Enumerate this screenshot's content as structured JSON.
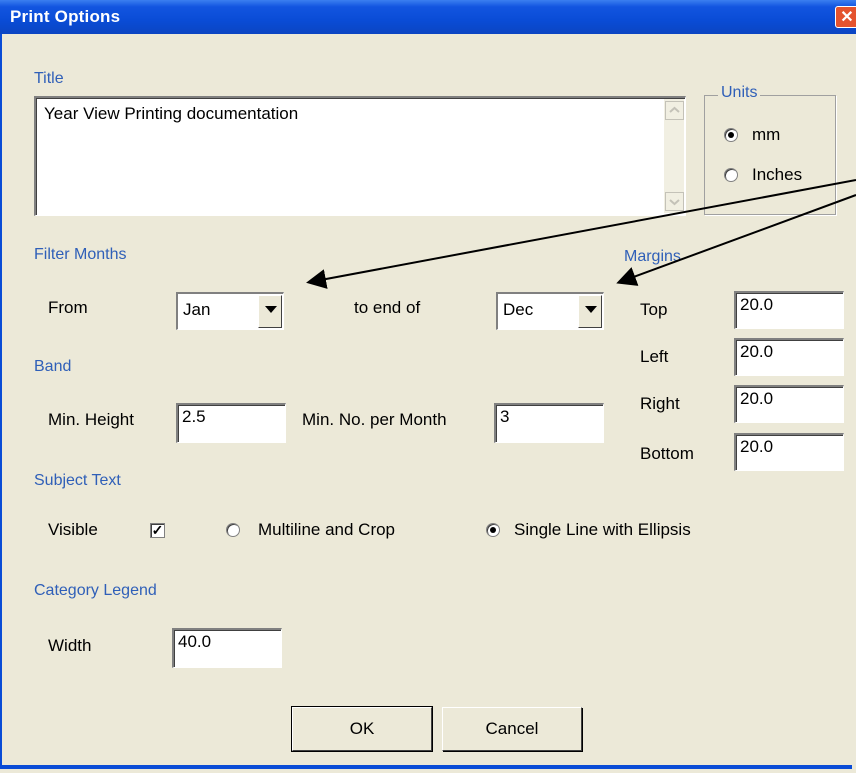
{
  "window": {
    "title": "Print Options",
    "close_label": "✕"
  },
  "title_section": {
    "label": "Title",
    "value": "Year View Printing documentation"
  },
  "units": {
    "label": "Units",
    "options": [
      "mm",
      "Inches"
    ],
    "selected": "mm"
  },
  "filter_months": {
    "label": "Filter Months",
    "from_label": "From",
    "from_value": "Jan",
    "to_label": "to end of",
    "to_value": "Dec"
  },
  "margins": {
    "label": "Margins",
    "top_label": "Top",
    "top": "20.0",
    "left_label": "Left",
    "left": "20.0",
    "right_label": "Right",
    "right": "20.0",
    "bottom_label": "Bottom",
    "bottom": "20.0"
  },
  "band": {
    "label": "Band",
    "min_height_label": "Min. Height",
    "min_height": "2.5",
    "min_no_label": "Min. No. per Month",
    "min_no": "3"
  },
  "subject_text": {
    "label": "Subject Text",
    "visible_label": "Visible",
    "visible_check": "✓",
    "multiline_label": "Multiline and Crop",
    "single_line_label": "Single Line with Ellipsis",
    "selected": "single_line"
  },
  "category_legend": {
    "label": "Category Legend",
    "width_label": "Width",
    "width": "40.0"
  },
  "buttons": {
    "ok": "OK",
    "cancel": "Cancel"
  }
}
